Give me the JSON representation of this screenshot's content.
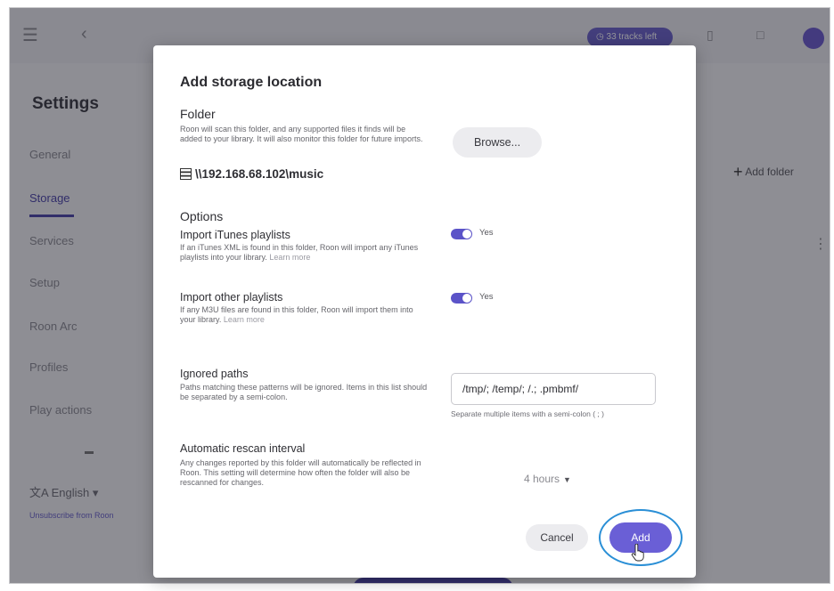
{
  "app": {
    "menu_icon": "menu-icon",
    "back_icon": "back-icon",
    "status_pill_label": "33 tracks left",
    "sidebar": {
      "title": "Settings",
      "items": [
        {
          "label": "General"
        },
        {
          "label": "Storage"
        },
        {
          "label": "Services"
        },
        {
          "label": "Setup"
        },
        {
          "label": "Roon Arc"
        },
        {
          "label": "Profiles"
        },
        {
          "label": "Play actions"
        }
      ],
      "language": "English",
      "link": "Unsubscribe from Roon"
    },
    "add_folder_label": "Add folder"
  },
  "dialog": {
    "title": "Add storage location",
    "folder": {
      "heading": "Folder",
      "description": "Roon will scan this folder, and any supported files it finds will be added to your library. It will also monitor this folder for future imports.",
      "browse_label": "Browse...",
      "path": "\\\\192.168.68.102\\music"
    },
    "options": {
      "heading": "Options",
      "import_itunes": {
        "title": "Import iTunes playlists",
        "description": "If an iTunes XML is found in this folder, Roon will import any iTunes playlists into your library.",
        "learn_more": "Learn more",
        "toggle_label": "Yes",
        "enabled": true
      },
      "import_other": {
        "title": "Import other playlists",
        "description": "If any M3U files are found in this folder, Roon will import them into your library.",
        "learn_more": "Learn more",
        "toggle_label": "Yes",
        "enabled": true
      }
    },
    "ignored_paths": {
      "title": "Ignored paths",
      "description": "Paths matching these patterns will be ignored. Items in this list should be separated by a semi-colon.",
      "value": "/tmp/; /temp/; /.; .pmbmf/",
      "hint": "Separate multiple items with a semi-colon ( ; )"
    },
    "rescan": {
      "title": "Automatic rescan interval",
      "description": "Any changes reported by this folder will automatically be reflected in Roon. This setting will determine how often the folder will also be rescanned for changes.",
      "value": "4 hours"
    },
    "cancel_label": "Cancel",
    "add_label": "Add"
  }
}
